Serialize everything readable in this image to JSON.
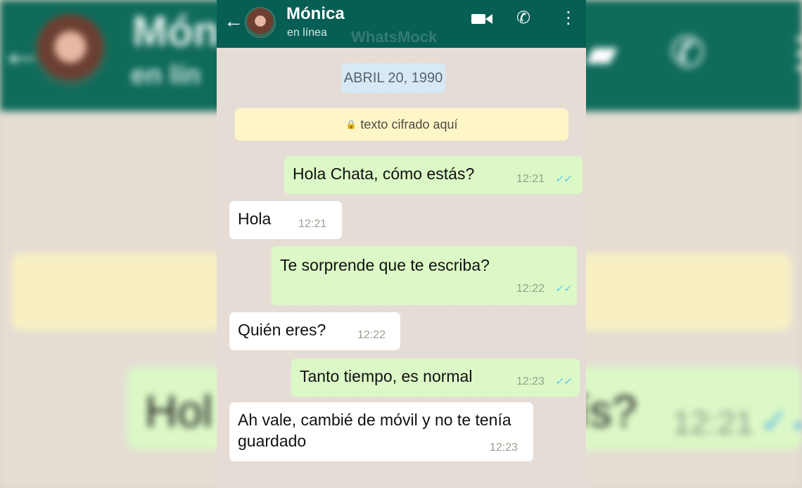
{
  "app": {
    "watermark": "WhatsMock"
  },
  "header": {
    "contact_name": "Mónica",
    "status": "en línea",
    "back_icon": "arrow-left-icon",
    "video_icon": "video-camera-icon",
    "call_icon": "phone-icon",
    "menu_icon": "more-vertical-icon"
  },
  "chat": {
    "date_label": "ABRIL 20, 1990",
    "encryption_notice": "texto cifrado aquí",
    "messages": [
      {
        "direction": "outgoing",
        "text": "Hola Chata, cómo estás?",
        "time": "12:21",
        "read": true
      },
      {
        "direction": "incoming",
        "text": "Hola",
        "time": "12:21"
      },
      {
        "direction": "outgoing",
        "text": "Te sorprende que te escriba?",
        "time": "12:22",
        "read": true
      },
      {
        "direction": "incoming",
        "text": "Quién eres?",
        "time": "12:22"
      },
      {
        "direction": "outgoing",
        "text": "Tanto tiempo, es normal",
        "time": "12:23",
        "read": true
      },
      {
        "direction": "incoming",
        "text": "Ah vale, cambié de móvil y no te tenía guardado",
        "time": "12:23"
      }
    ]
  },
  "background": {
    "name_partial": "Món",
    "status_partial": "en lín",
    "bubble_text_partial": "Hol",
    "bubble_text_partial_2": "ís?",
    "bubble_time": "12:21"
  },
  "colors": {
    "header": "#075e54",
    "outgoing_bubble": "#dcf8c6",
    "incoming_bubble": "#ffffff",
    "date_chip": "#d7e9f5",
    "encryption_notice": "#fff6c8",
    "read_tick": "#4fc3f7"
  }
}
